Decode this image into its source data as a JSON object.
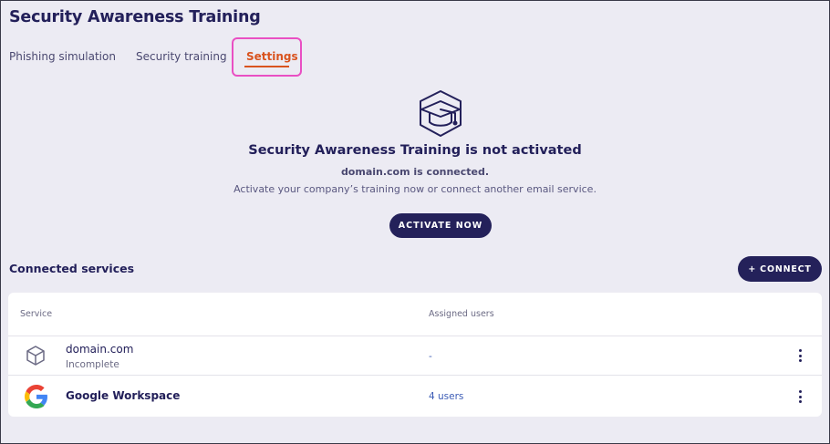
{
  "page": {
    "title": "Security Awareness Training"
  },
  "tabs": [
    {
      "label": "Phishing simulation"
    },
    {
      "label": "Security training"
    },
    {
      "label": "Settings",
      "active": true
    }
  ],
  "hero": {
    "icon": "graduation-cap-icon",
    "title": "Security Awareness Training is not activated",
    "line1": "domain.com is connected.",
    "line2": "Activate your company’s training now or connect another email service.",
    "button_label": "ACTIVATE NOW"
  },
  "services": {
    "title": "Connected services",
    "connect_label": "+ CONNECT",
    "columns": {
      "service": "Service",
      "assigned": "Assigned users"
    },
    "rows": [
      {
        "icon": "cube-icon",
        "name": "domain.com",
        "status": "Incomplete",
        "assigned": "-"
      },
      {
        "icon": "google-logo-icon",
        "name": "Google Workspace",
        "status": "",
        "assigned": "4 users"
      }
    ]
  },
  "colors": {
    "primary": "#24215a",
    "accent": "#d9531e",
    "highlight": "#e94fc3",
    "link": "#3b5bb5",
    "background": "#ecebf3"
  }
}
